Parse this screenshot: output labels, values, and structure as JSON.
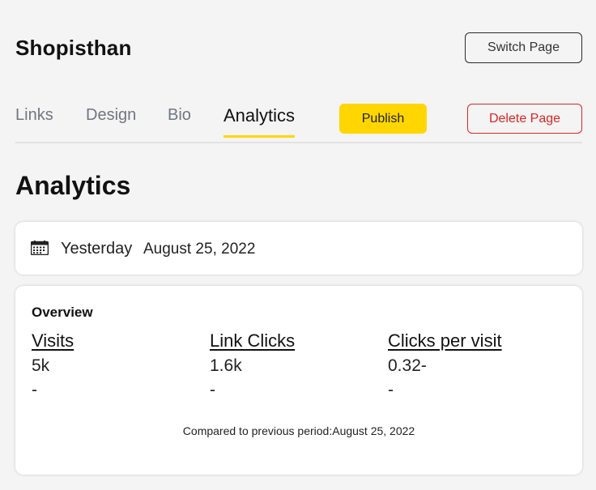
{
  "header": {
    "brand": "Shopisthan",
    "switch_label": "Switch Page"
  },
  "tabs": [
    {
      "label": "Links",
      "active": false
    },
    {
      "label": "Design",
      "active": false
    },
    {
      "label": "Bio",
      "active": false
    },
    {
      "label": "Analytics",
      "active": true
    }
  ],
  "actions": {
    "publish_label": "Publish",
    "delete_label": "Delete Page"
  },
  "section_title": "Analytics",
  "date_filter": {
    "icon": "calendar-icon",
    "range": "Yesterday",
    "date": "August 25, 2022"
  },
  "overview": {
    "title": "Overview",
    "metrics": [
      {
        "label": "Visits",
        "value": "5k",
        "change": "-"
      },
      {
        "label": "Link Clicks",
        "value": "1.6k",
        "change": "-"
      },
      {
        "label": "Clicks per visit",
        "value": "0.32-",
        "change": "-"
      }
    ],
    "compare_text": "Compared to previous period:August 25, 2022"
  },
  "colors": {
    "accent": "#ffd600",
    "danger": "#e02424",
    "background": "#f4f4f4"
  }
}
